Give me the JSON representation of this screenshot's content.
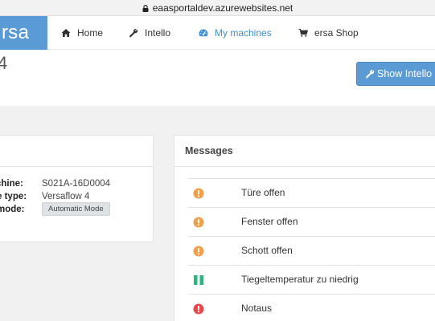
{
  "browser": {
    "url": "eaasportaldev.azurewebsites.net"
  },
  "brand": {
    "text": "rsa"
  },
  "nav": [
    {
      "label": "Home",
      "icon": "home-icon"
    },
    {
      "label": "Intello",
      "icon": "wrench-icon"
    },
    {
      "label": "My machines",
      "icon": "dashboard-icon",
      "active": true
    },
    {
      "label": "ersa Shop",
      "icon": "cart-icon"
    }
  ],
  "page": {
    "title_fragment": "4",
    "show_button_label": "Show Intello"
  },
  "machine": {
    "rows": [
      {
        "key": "chine:",
        "value": "S021A-16D0004"
      },
      {
        "key": "e type:",
        "value": "Versaflow 4"
      },
      {
        "key": "mode:",
        "value": "Automatic Mode"
      }
    ]
  },
  "messages": {
    "title": "Messages",
    "items": [
      {
        "text": "Türe offen",
        "severity": "warning"
      },
      {
        "text": "Fenster offen",
        "severity": "warning"
      },
      {
        "text": "Schott offen",
        "severity": "warning"
      },
      {
        "text": "Tiegeltemperatur zu niedrig",
        "severity": "paused"
      },
      {
        "text": "Notaus",
        "severity": "error"
      }
    ]
  },
  "colors": {
    "brand": "#5a9bd5",
    "active_nav": "#3f8fd0",
    "warning": "#f0a04b",
    "paused": "#2fb37f",
    "error": "#e5484d"
  }
}
